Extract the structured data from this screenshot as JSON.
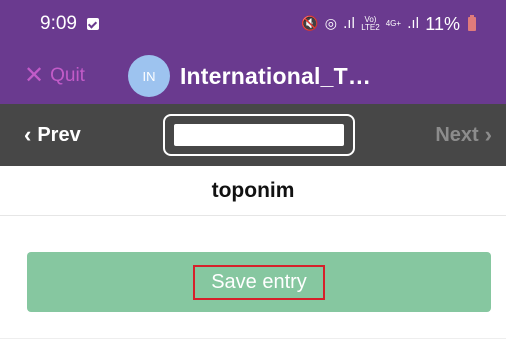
{
  "status_bar": {
    "time": "9:09",
    "mute_symbol": "🔇",
    "wifi_symbol": "◎",
    "volte_text": "Vo)",
    "lte_text": "LTE2",
    "net_text": "4G+",
    "battery_percent": "11%",
    "icons": [
      "notification-icon",
      "mute-icon",
      "hotspot-icon",
      "signal-icon",
      "battery-icon"
    ]
  },
  "header": {
    "quit_label": "Quit",
    "avatar_initials": "IN",
    "title": "International_T…"
  },
  "nav": {
    "prev_label": "Prev",
    "next_label": "Next",
    "input_value": "",
    "input_placeholder": ""
  },
  "entry": {
    "title": "toponim",
    "save_label": "Save entry"
  },
  "colors": {
    "header_bg": "#6a3a8f",
    "nav_bg": "#474747",
    "save_bg": "#86c7a0",
    "highlight_border": "#d6202a"
  }
}
